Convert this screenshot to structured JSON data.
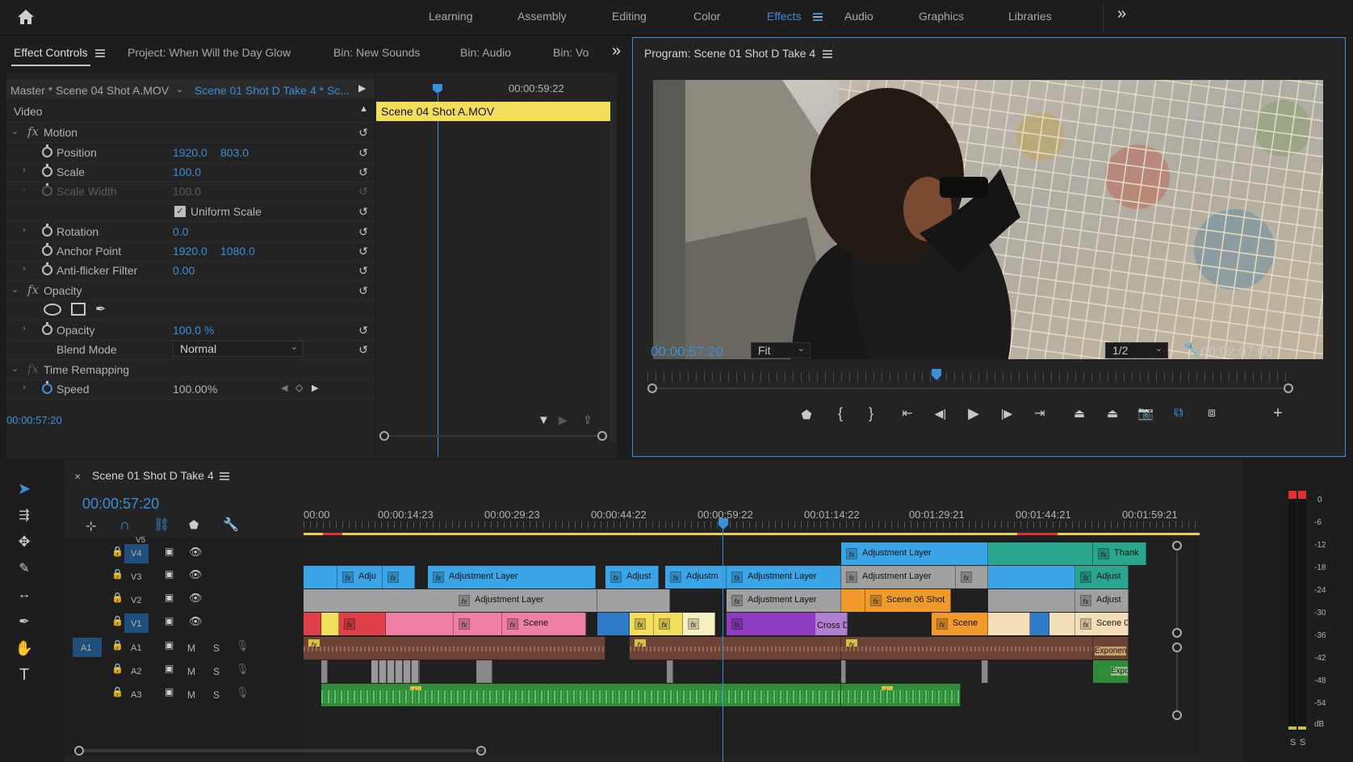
{
  "workspaces": {
    "items": [
      "Learning",
      "Assembly",
      "Editing",
      "Color",
      "Effects",
      "Audio",
      "Graphics",
      "Libraries"
    ],
    "active": "Effects",
    "overflow": "»"
  },
  "effect_controls": {
    "tabs": [
      "Effect Controls",
      "Project: When Will the Day Glow",
      "Bin: New Sounds",
      "Bin: Audio",
      "Bin: Vo"
    ],
    "master_label": "Master * Scene 04 Shot A.MOV",
    "sequence_label": "Scene 01 Shot D Take 4 * Sc...",
    "mini_time": "00:00:59:22",
    "clip_bar": "Scene 04 Shot A.MOV",
    "section_video": "Video",
    "motion": "Motion",
    "position_label": "Position",
    "position_x": "1920.0",
    "position_y": "803.0",
    "scale_label": "Scale",
    "scale_val": "100.0",
    "scale_width_label": "Scale Width",
    "scale_width_val": "100.0",
    "uniform_scale": "Uniform Scale",
    "rotation_label": "Rotation",
    "rotation_val": "0.0",
    "anchor_label": "Anchor Point",
    "anchor_x": "1920.0",
    "anchor_y": "1080.0",
    "antiflicker_label": "Anti-flicker Filter",
    "antiflicker_val": "0.00",
    "opacity_section": "Opacity",
    "opacity_label": "Opacity",
    "opacity_val": "100.0 %",
    "blend_label": "Blend Mode",
    "blend_val": "Normal",
    "time_remap": "Time Remapping",
    "speed_label": "Speed",
    "speed_val": "100.00%",
    "footer_time": "00:00:57:20"
  },
  "program": {
    "title": "Program: Scene 01 Shot D Take 4",
    "timecode": "00:00:57:20",
    "fit": "Fit",
    "resolution": "1/2",
    "duration": "00:02:07:00"
  },
  "timeline": {
    "title": "Scene 01 Shot D Take 4",
    "close": "×",
    "timecode": "00:00:57:20",
    "ruler": [
      "00:00",
      "00:00:14:23",
      "00:00:29:23",
      "00:00:44:22",
      "00:00:59:22",
      "00:01:14:22",
      "00:01:29:21",
      "00:01:44:21",
      "00:01:59:21"
    ],
    "tracks": {
      "v5": "V5",
      "v4": "V4",
      "v3": "V3",
      "v2": "V2",
      "v1": "V1",
      "a1_src": "A1",
      "a1": "A1",
      "a2": "A2",
      "a3": "A3",
      "m": "M",
      "s": "S"
    },
    "clips": {
      "v4_adj": "Adjustment Layer",
      "v4_thank": "Thank",
      "v3_adju": "Adju",
      "v3_adj1": "Adjustment Layer",
      "v3_adjust": "Adjust",
      "v3_adjustm": "Adjustm",
      "v3_adj2": "Adjustment Layer",
      "v3_adj3": "Adjustment Layer",
      "v3_adjust2": "Adjust",
      "v2_adj1": "Adjustment Layer",
      "v2_adj2": "Adjustment Layer",
      "v2_scene06": "Scene 06 Shot",
      "v2_adjust": "Adjust",
      "v1_scene": "Scene",
      "v1_cross": "Cross Di",
      "v1_scene2": "Scene",
      "v1_scene0": "Scene 0",
      "a1_exponen": "Exponen",
      "a2_expo": "Expo"
    }
  },
  "meter": {
    "scale": [
      "0",
      "-6",
      "-12",
      "-18",
      "-24",
      "-30",
      "-36",
      "-42",
      "-48",
      "-54",
      "dB"
    ],
    "solo": [
      "S",
      "S"
    ]
  },
  "colors": {
    "accent": "#3a8fdb",
    "adjustment": "#3aa6e8",
    "pink": "#ef7fa6",
    "green_audio": "#2f8a3a",
    "brown_audio": "#6b4436",
    "clip_header": "#f2de5a",
    "teal": "#2aa58e"
  },
  "icons": [
    "home-icon",
    "stopwatch-icon",
    "reset-icon",
    "fx-icon",
    "ellipse-mask-icon",
    "rect-mask-icon",
    "pen-mask-icon",
    "selection-tool-icon",
    "track-select-icon",
    "ripple-edit-icon",
    "razor-icon",
    "slip-icon",
    "pen-tool-icon",
    "hand-icon",
    "type-icon",
    "marker-icon",
    "wrench-icon",
    "play-icon",
    "camera-icon",
    "lock-icon",
    "eye-icon",
    "mic-icon"
  ]
}
